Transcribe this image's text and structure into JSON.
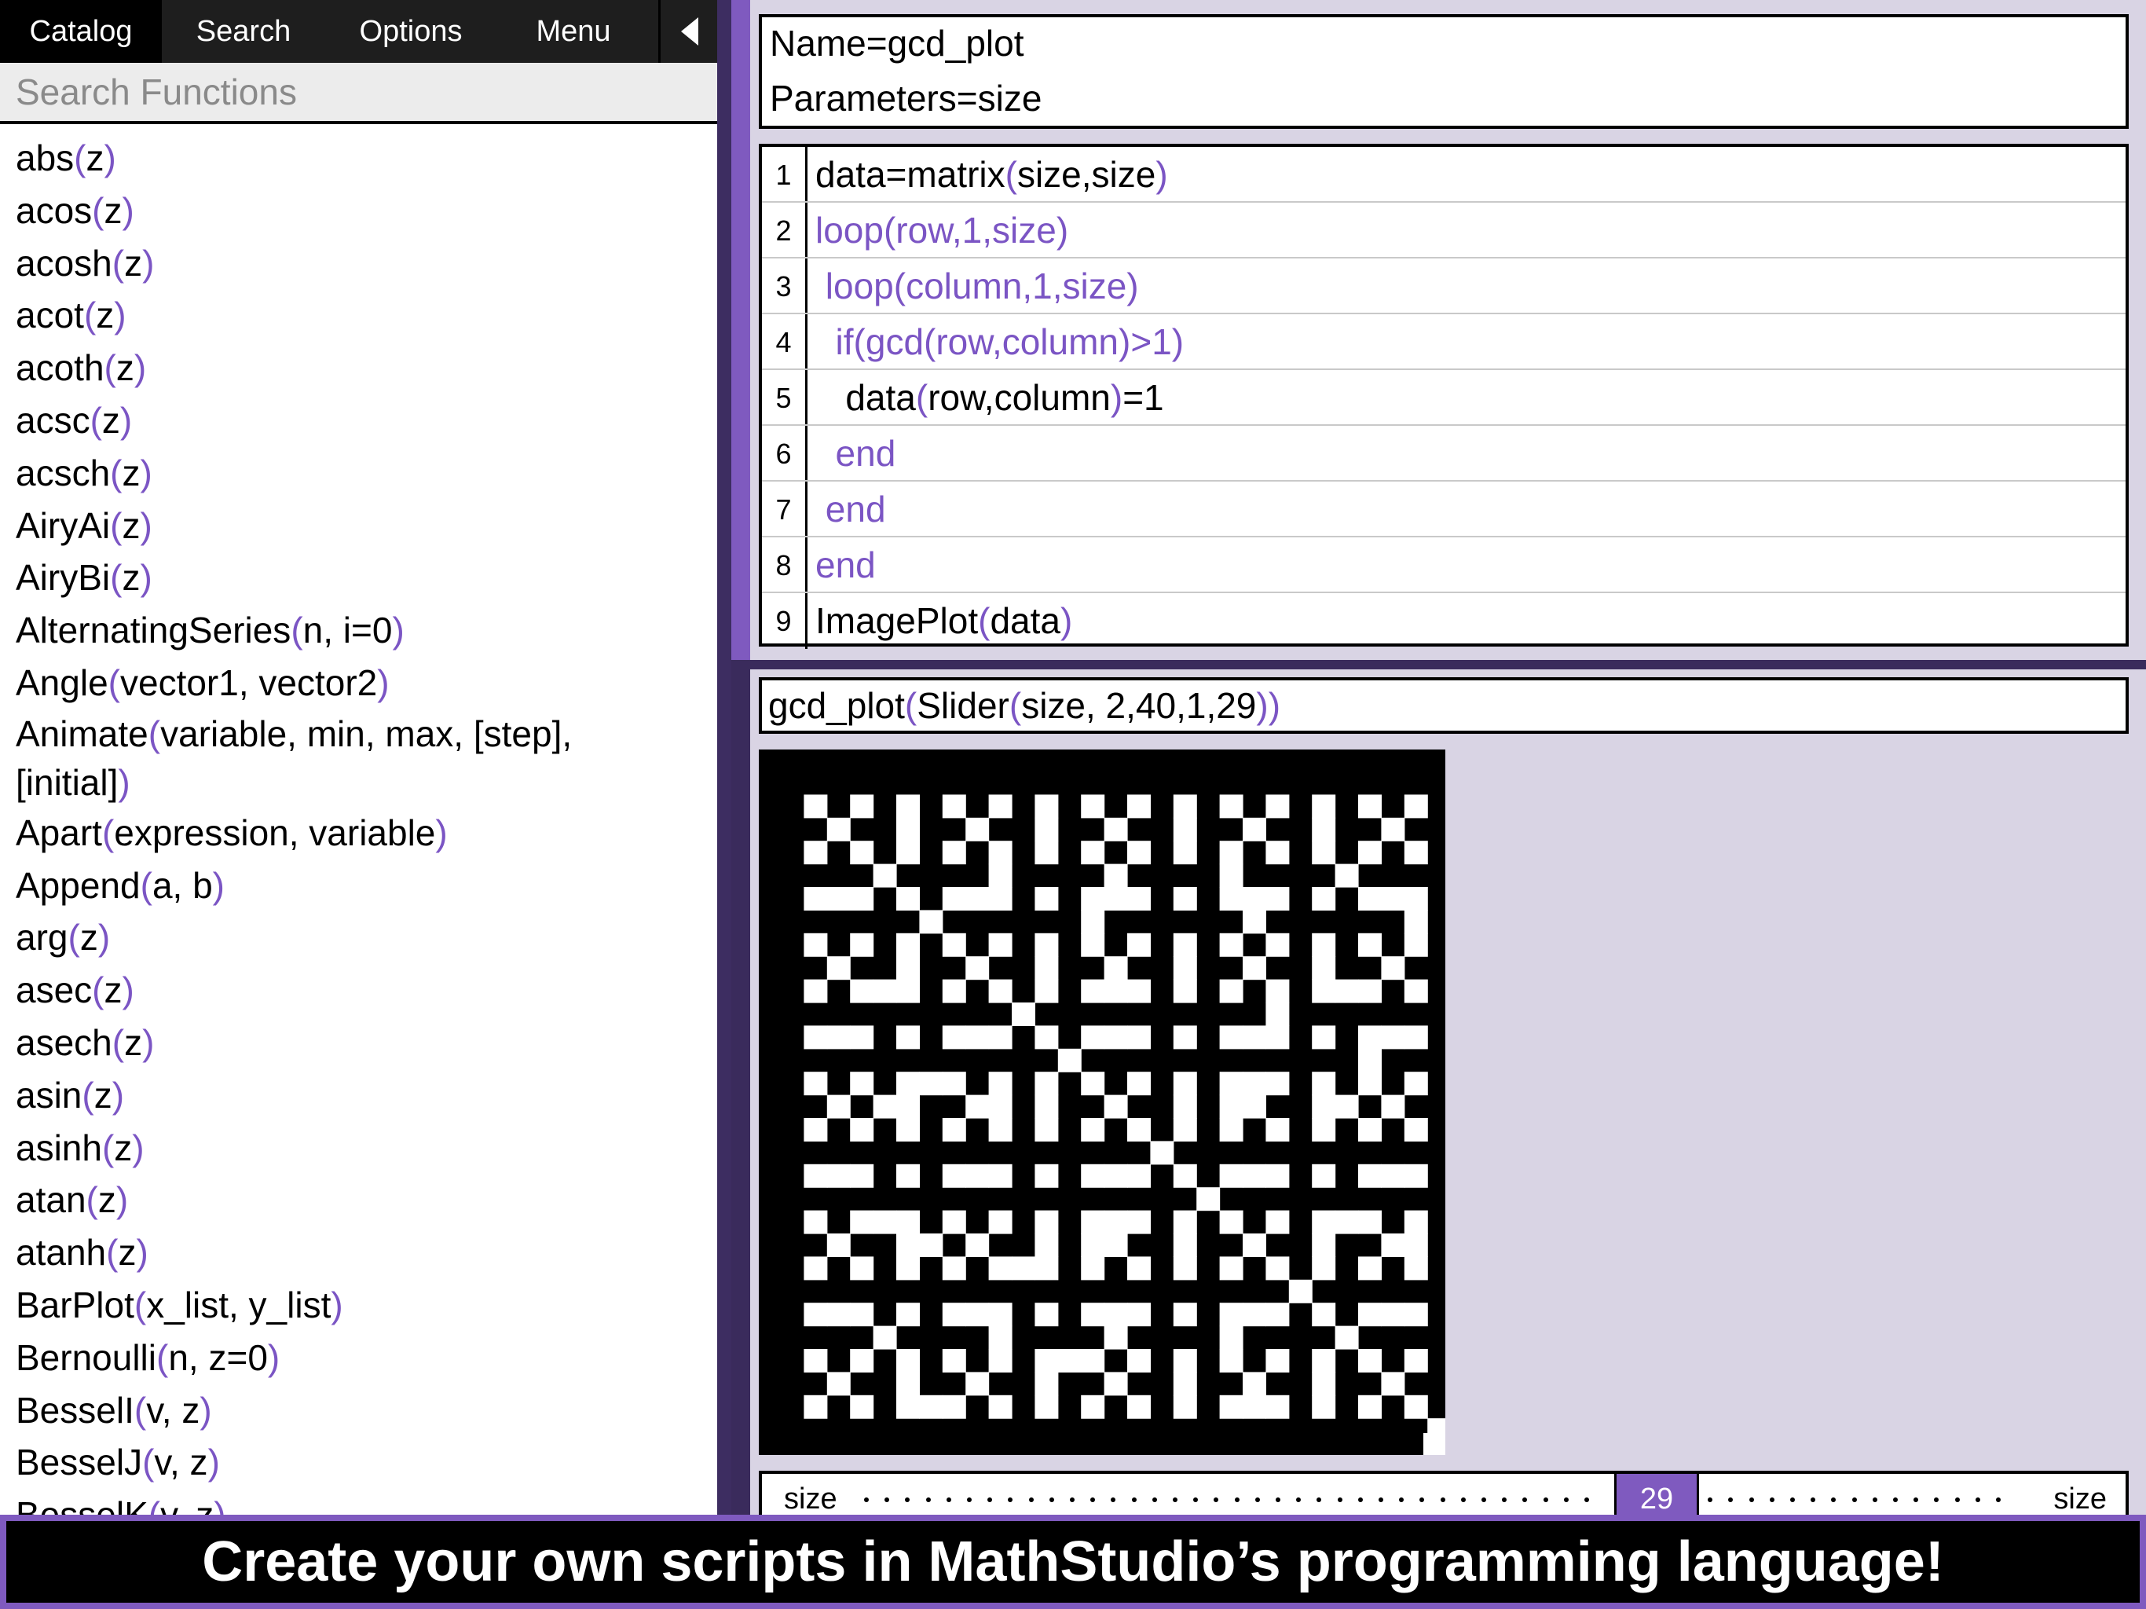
{
  "tabs": [
    {
      "label": "Catalog",
      "active": true
    },
    {
      "label": "Search",
      "active": false
    },
    {
      "label": "Options",
      "active": false
    },
    {
      "label": "Menu",
      "active": false
    }
  ],
  "collapse_icon": "chevron-left-icon",
  "search": {
    "placeholder": "Search Functions"
  },
  "functions": [
    {
      "name": "abs",
      "args": "z"
    },
    {
      "name": "acos",
      "args": "z"
    },
    {
      "name": "acosh",
      "args": "z"
    },
    {
      "name": "acot",
      "args": "z"
    },
    {
      "name": "acoth",
      "args": "z"
    },
    {
      "name": "acsc",
      "args": "z"
    },
    {
      "name": "acsch",
      "args": "z"
    },
    {
      "name": "AiryAi",
      "args": "z"
    },
    {
      "name": "AiryBi",
      "args": "z"
    },
    {
      "name": "AlternatingSeries",
      "args": "n, i=0"
    },
    {
      "name": "Angle",
      "args": "vector1, vector2"
    },
    {
      "name": "Animate",
      "args": "variable, min, max, [step],",
      "args2": "[initial]"
    },
    {
      "name": "Apart",
      "args": "expression, variable"
    },
    {
      "name": "Append",
      "args": "a, b"
    },
    {
      "name": "arg",
      "args": "z"
    },
    {
      "name": "asec",
      "args": "z"
    },
    {
      "name": "asech",
      "args": "z"
    },
    {
      "name": "asin",
      "args": "z"
    },
    {
      "name": "asinh",
      "args": "z"
    },
    {
      "name": "atan",
      "args": "z"
    },
    {
      "name": "atanh",
      "args": "z"
    },
    {
      "name": "BarPlot",
      "args": "x_list, y_list"
    },
    {
      "name": "Bernoulli",
      "args": "n, z=0"
    },
    {
      "name": "BesselI",
      "args": "v, z"
    },
    {
      "name": "BesselJ",
      "args": "v, z"
    },
    {
      "name": "BesselK",
      "args": "v, z"
    }
  ],
  "script": {
    "name_line": "Name=gcd_plot",
    "params_line": "Parameters=size",
    "lines": [
      {
        "n": "1",
        "segs": [
          [
            "k",
            "data=matrix"
          ],
          [
            "p",
            "("
          ],
          [
            "k",
            "size,size"
          ],
          [
            "p",
            ")"
          ]
        ]
      },
      {
        "n": "2",
        "segs": [
          [
            "p",
            "loop(row,1,size)"
          ]
        ]
      },
      {
        "n": "3",
        "segs": [
          [
            "p",
            " loop(column,1,size)"
          ]
        ]
      },
      {
        "n": "4",
        "segs": [
          [
            "p",
            "  if(gcd(row,column)>1)"
          ]
        ]
      },
      {
        "n": "5",
        "segs": [
          [
            "k",
            "   data"
          ],
          [
            "p",
            "("
          ],
          [
            "k",
            "row,column"
          ],
          [
            "p",
            ")"
          ],
          [
            "k",
            "=1"
          ]
        ]
      },
      {
        "n": "6",
        "segs": [
          [
            "p",
            "  end"
          ]
        ]
      },
      {
        "n": "7",
        "segs": [
          [
            "p",
            " end"
          ]
        ]
      },
      {
        "n": "8",
        "segs": [
          [
            "p",
            "end"
          ]
        ]
      },
      {
        "n": "9",
        "segs": [
          [
            "k",
            "ImagePlot"
          ],
          [
            "p",
            "("
          ],
          [
            "k",
            "data"
          ],
          [
            "p",
            ")"
          ]
        ]
      }
    ]
  },
  "call": {
    "segs": [
      [
        "k",
        "gcd_plot"
      ],
      [
        "p",
        "("
      ],
      [
        "k",
        "Slider"
      ],
      [
        "p",
        "("
      ],
      [
        "k",
        "size, 2,40,1,29"
      ],
      [
        "p",
        "))"
      ]
    ]
  },
  "image_plot": {
    "size": 29
  },
  "slider": {
    "label_left": "size",
    "label_right": "size",
    "value": "29",
    "min": 2,
    "max": 40,
    "step": 1
  },
  "caption": "Create your own scripts in MathStudio’s programming language!",
  "colors": {
    "accent": "#7f5abf",
    "dark_purple": "#3a2b5c",
    "code_purple": "#7b55c4",
    "panel_bg": "#d9d4e4"
  }
}
